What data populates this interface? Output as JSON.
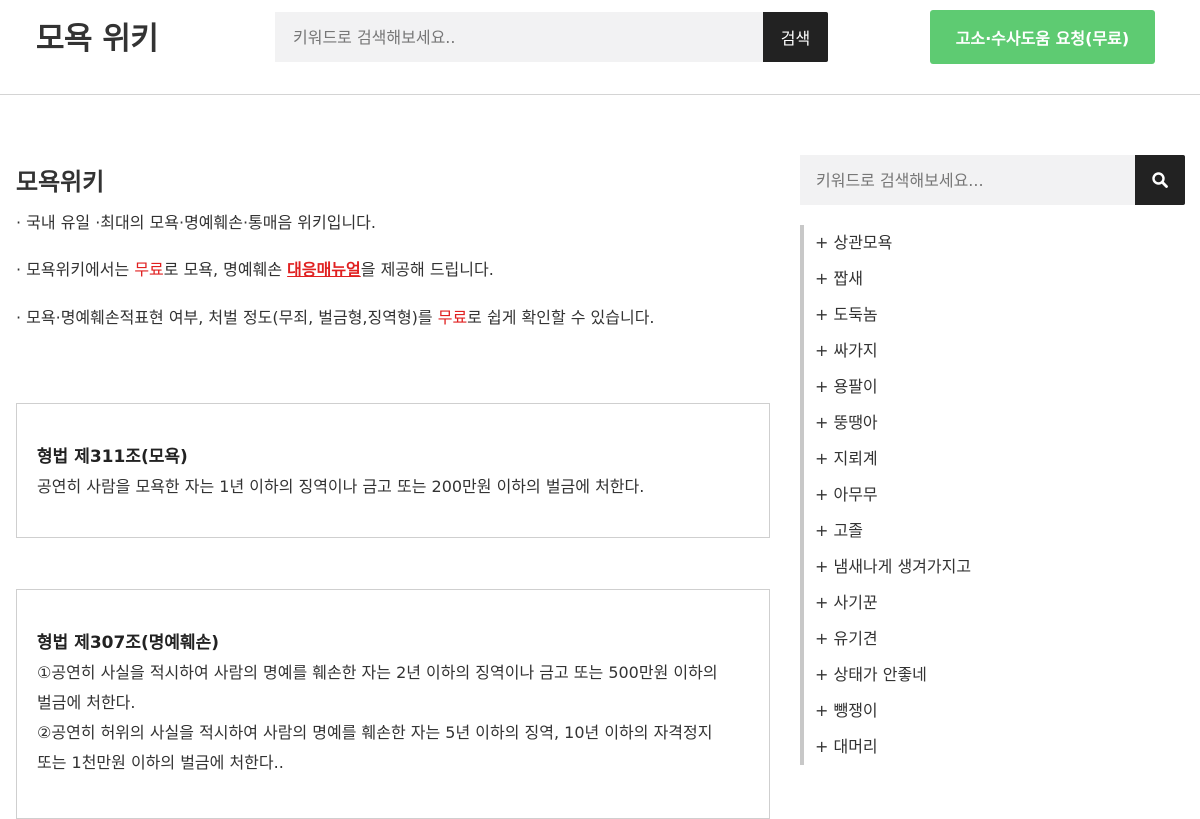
{
  "header": {
    "logo": "모욕 위키",
    "search_placeholder": "키워드로 검색해보세요..",
    "search_button": "검색",
    "cta": "고소·수사도움 요청(무료)"
  },
  "main": {
    "title": "모욕위키",
    "intro": {
      "line1": "· 국내 유일 ·최대의 모욕·명예훼손·통매음 위키입니다.",
      "line2_a": "· 모욕위키에서는 ",
      "line2_red": "무료",
      "line2_b": "로 모욕, 명예훼손 ",
      "line2_link": "대응매뉴얼",
      "line2_c": "을 제공해 드립니다.",
      "line3_a": "· 모욕·명예훼손적표현 여부, 처벌 정도(무죄, 벌금형,징역형)를 ",
      "line3_red": "무료",
      "line3_b": "로 쉽게 확인할 수 있습니다."
    },
    "laws": [
      {
        "title": "형법 제311조(모욕)",
        "body": [
          "공연히 사람을 모욕한 자는 1년 이하의 징역이나 금고 또는 200만원 이하의 벌금에 처한다."
        ]
      },
      {
        "title": "형법 제307조(명예훼손)",
        "body": [
          "①공연히 사실을 적시하여 사람의 명예를 훼손한 자는 2년 이하의 징역이나 금고 또는 500만원 이하의",
          "벌금에 처한다.",
          "②공연히 허위의 사실을 적시하여 사람의 명예를 훼손한 자는 5년 이하의 징역, 10년 이하의 자격정지",
          "또는 1천만원 이하의 벌금에 처한다.."
        ]
      }
    ]
  },
  "sidebar": {
    "search_placeholder": "키워드로 검색해보세요...",
    "items": [
      "+ 상관모욕",
      "+ 짭새",
      "+ 도둑놈",
      "+ 싸가지",
      "+ 용팔이",
      "+ 뚱땡아",
      "+ 지뢰계",
      "+ 아무무",
      "+ 고졸",
      "+ 냄새나게 생겨가지고",
      "+ 사기꾼",
      "+ 유기견",
      "+ 상태가 안좋네",
      "+ 뺑쟁이",
      "+ 대머리"
    ]
  },
  "colors": {
    "cta": "#5ecb72",
    "accent_red": "#e02020",
    "dark_button": "#222222"
  }
}
